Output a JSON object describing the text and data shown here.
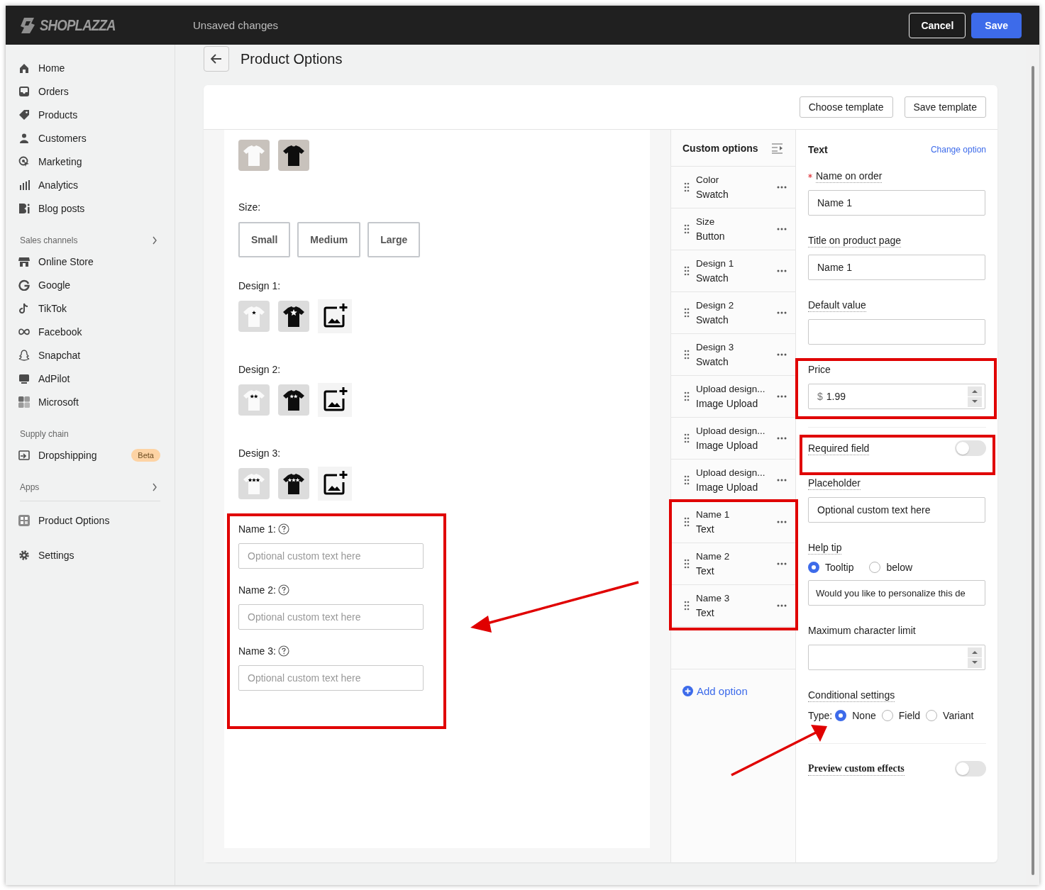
{
  "topbar": {
    "logo": "SHOPLAZZA",
    "status": "Unsaved changes",
    "buttons": [
      {
        "label": "Cancel",
        "kind": "secondary"
      },
      {
        "label": "Save",
        "kind": "primary"
      }
    ]
  },
  "sidebar": {
    "groups": [
      {
        "items": [
          {
            "label": "Home"
          },
          {
            "label": "Orders"
          },
          {
            "label": "Products"
          },
          {
            "label": "Customers"
          },
          {
            "label": "Marketing"
          },
          {
            "label": "Analytics"
          },
          {
            "label": "Blog posts"
          }
        ]
      },
      {
        "title": "Sales channels",
        "expandable": true,
        "items": [
          {
            "label": "Online Store"
          },
          {
            "label": "Google"
          },
          {
            "label": "TikTok"
          },
          {
            "label": "Facebook"
          },
          {
            "label": "Snapchat"
          },
          {
            "label": "AdPilot"
          },
          {
            "label": "Microsoft"
          }
        ]
      },
      {
        "title": "Supply chain",
        "expandable": false,
        "items": [
          {
            "label": "Dropshipping",
            "badge": "Beta"
          }
        ]
      },
      {
        "title": "Apps",
        "expandable": true,
        "items": [
          {
            "label": "Product Options"
          }
        ]
      },
      {
        "items": [
          {
            "label": "Settings"
          }
        ]
      }
    ]
  },
  "page": {
    "title": "Product Options"
  },
  "card": {
    "buttons": [
      "Choose template",
      "Save template"
    ]
  },
  "preview": {
    "color_swatches": [
      {
        "kind": "light"
      },
      {
        "kind": "dark"
      }
    ],
    "size": {
      "label": "Size:",
      "choices": [
        "Small",
        "Medium",
        "Large"
      ]
    },
    "designs": [
      {
        "label": "Design 1:",
        "swatches": [
          {
            "kind": "light"
          },
          {
            "kind": "dark"
          }
        ]
      },
      {
        "label": "Design 2:",
        "swatches": [
          {
            "kind": "light"
          },
          {
            "kind": "dark"
          }
        ]
      },
      {
        "label": "Design 3:",
        "swatches": [
          {
            "kind": "light"
          },
          {
            "kind": "dark"
          }
        ]
      }
    ],
    "text_fields": [
      {
        "label": "Name 1:",
        "placeholder": "Optional custom text here"
      },
      {
        "label": "Name 2:",
        "placeholder": "Optional custom text here"
      },
      {
        "label": "Name 3:",
        "placeholder": "Optional custom text here"
      }
    ]
  },
  "options": {
    "title": "Custom options",
    "items": [
      {
        "name": "Color",
        "type": "Swatch"
      },
      {
        "name": "Size",
        "type": "Button"
      },
      {
        "name": "Design 1",
        "type": "Swatch"
      },
      {
        "name": "Design 2",
        "type": "Swatch"
      },
      {
        "name": "Design 3",
        "type": "Swatch"
      },
      {
        "name": "Upload design...",
        "type": "Image Upload"
      },
      {
        "name": "Upload design...",
        "type": "Image Upload"
      },
      {
        "name": "Upload design...",
        "type": "Image Upload"
      },
      {
        "name": "Name 1",
        "type": "Text"
      },
      {
        "name": "Name 2",
        "type": "Text"
      },
      {
        "name": "Name 3",
        "type": "Text"
      }
    ],
    "add": "Add option"
  },
  "settings": {
    "title": "Text",
    "change_link": "Change option",
    "fields": [
      {
        "kind": "text",
        "label": "Name on order",
        "required": true,
        "value": "Name 1"
      },
      {
        "kind": "text",
        "label": "Title on product page",
        "required": false,
        "value": "Name 1"
      },
      {
        "kind": "text",
        "label": "Default value",
        "required": false
      },
      {
        "kind": "number",
        "label": "Price",
        "prefix": "$",
        "value": "1.99"
      },
      {
        "kind": "toggle",
        "label": "Required field",
        "on": false
      },
      {
        "kind": "text",
        "label": "Placeholder",
        "required": false,
        "value": "Optional custom text here"
      },
      {
        "kind": "radio_text",
        "label": "Help tip",
        "options": [
          {
            "label": "Tooltip",
            "selected": true
          },
          {
            "label": "below",
            "selected": false
          }
        ],
        "value": "Would you like to personalize this de"
      },
      {
        "kind": "number",
        "label": "Maximum character limit"
      },
      {
        "kind": "radio",
        "label": "Conditional settings",
        "prefix": "Type:",
        "options": [
          {
            "label": "None",
            "selected": true
          },
          {
            "label": "Field",
            "selected": false
          },
          {
            "label": "Variant",
            "selected": false
          }
        ]
      },
      {
        "kind": "preview_toggle",
        "label": "Preview custom effects",
        "on": false
      }
    ]
  }
}
